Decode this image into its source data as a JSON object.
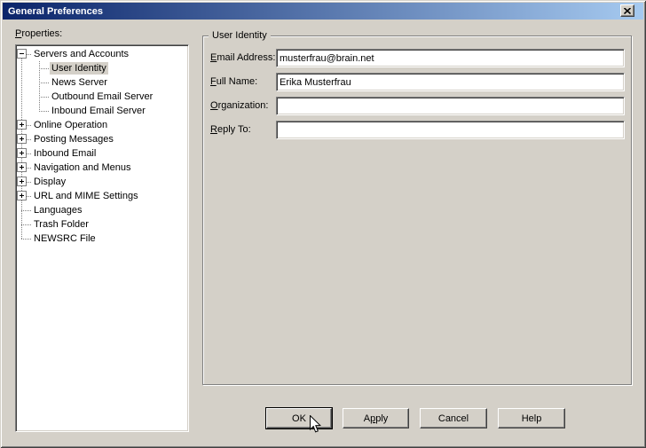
{
  "window": {
    "title": "General Preferences",
    "close_icon": "close-x"
  },
  "properties_panel": {
    "label": {
      "text": "Properties:",
      "mnemonic_index": 0
    },
    "tree_items": [
      {
        "label": "Servers and Accounts",
        "level": 0,
        "glyph": "minus",
        "selected": false
      },
      {
        "label": "User Identity",
        "level": 1,
        "glyph": "none",
        "selected": true
      },
      {
        "label": "News Server",
        "level": 1,
        "glyph": "none",
        "selected": false
      },
      {
        "label": "Outbound Email Server",
        "level": 1,
        "glyph": "none",
        "selected": false
      },
      {
        "label": "Inbound Email Server",
        "level": 1,
        "glyph": "none",
        "selected": false
      },
      {
        "label": "Online Operation",
        "level": 0,
        "glyph": "plus",
        "selected": false
      },
      {
        "label": "Posting Messages",
        "level": 0,
        "glyph": "plus",
        "selected": false
      },
      {
        "label": "Inbound Email",
        "level": 0,
        "glyph": "plus",
        "selected": false
      },
      {
        "label": "Navigation and Menus",
        "level": 0,
        "glyph": "plus",
        "selected": false
      },
      {
        "label": "Display",
        "level": 0,
        "glyph": "plus",
        "selected": false
      },
      {
        "label": "URL and MIME Settings",
        "level": 0,
        "glyph": "plus",
        "selected": false
      },
      {
        "label": "Languages",
        "level": 0,
        "glyph": "leaf",
        "selected": false
      },
      {
        "label": "Trash Folder",
        "level": 0,
        "glyph": "leaf",
        "selected": false
      },
      {
        "label": "NEWSRC File",
        "level": 0,
        "glyph": "leaf",
        "selected": false
      }
    ]
  },
  "form": {
    "group_title": "User Identity",
    "fields": [
      {
        "name": "email-address",
        "label": "Email Address:",
        "mnemonic_index": 0,
        "value": "musterfrau@brain.net"
      },
      {
        "name": "full-name",
        "label": "Full Name:",
        "mnemonic_index": 0,
        "value": "Erika Musterfrau"
      },
      {
        "name": "organization",
        "label": "Organization:",
        "mnemonic_index": 0,
        "value": ""
      },
      {
        "name": "reply-to",
        "label": "Reply To:",
        "mnemonic_index": 0,
        "value": ""
      }
    ]
  },
  "action_buttons": [
    {
      "name": "ok",
      "label": "OK",
      "mnemonic_index": -1,
      "default": true
    },
    {
      "name": "apply",
      "label": "Apply",
      "mnemonic_index": 1,
      "default": false
    },
    {
      "name": "cancel",
      "label": "Cancel",
      "mnemonic_index": -1,
      "default": false
    },
    {
      "name": "help",
      "label": "Help",
      "mnemonic_index": -1,
      "default": false
    }
  ],
  "colors": {
    "face": "#d4d0c8",
    "titlebar_left": "#0a246a",
    "titlebar_right": "#a6caf0",
    "title_text": "#ffffff",
    "selection_bg": "#d4d0c8",
    "field_bg": "#ffffff"
  }
}
